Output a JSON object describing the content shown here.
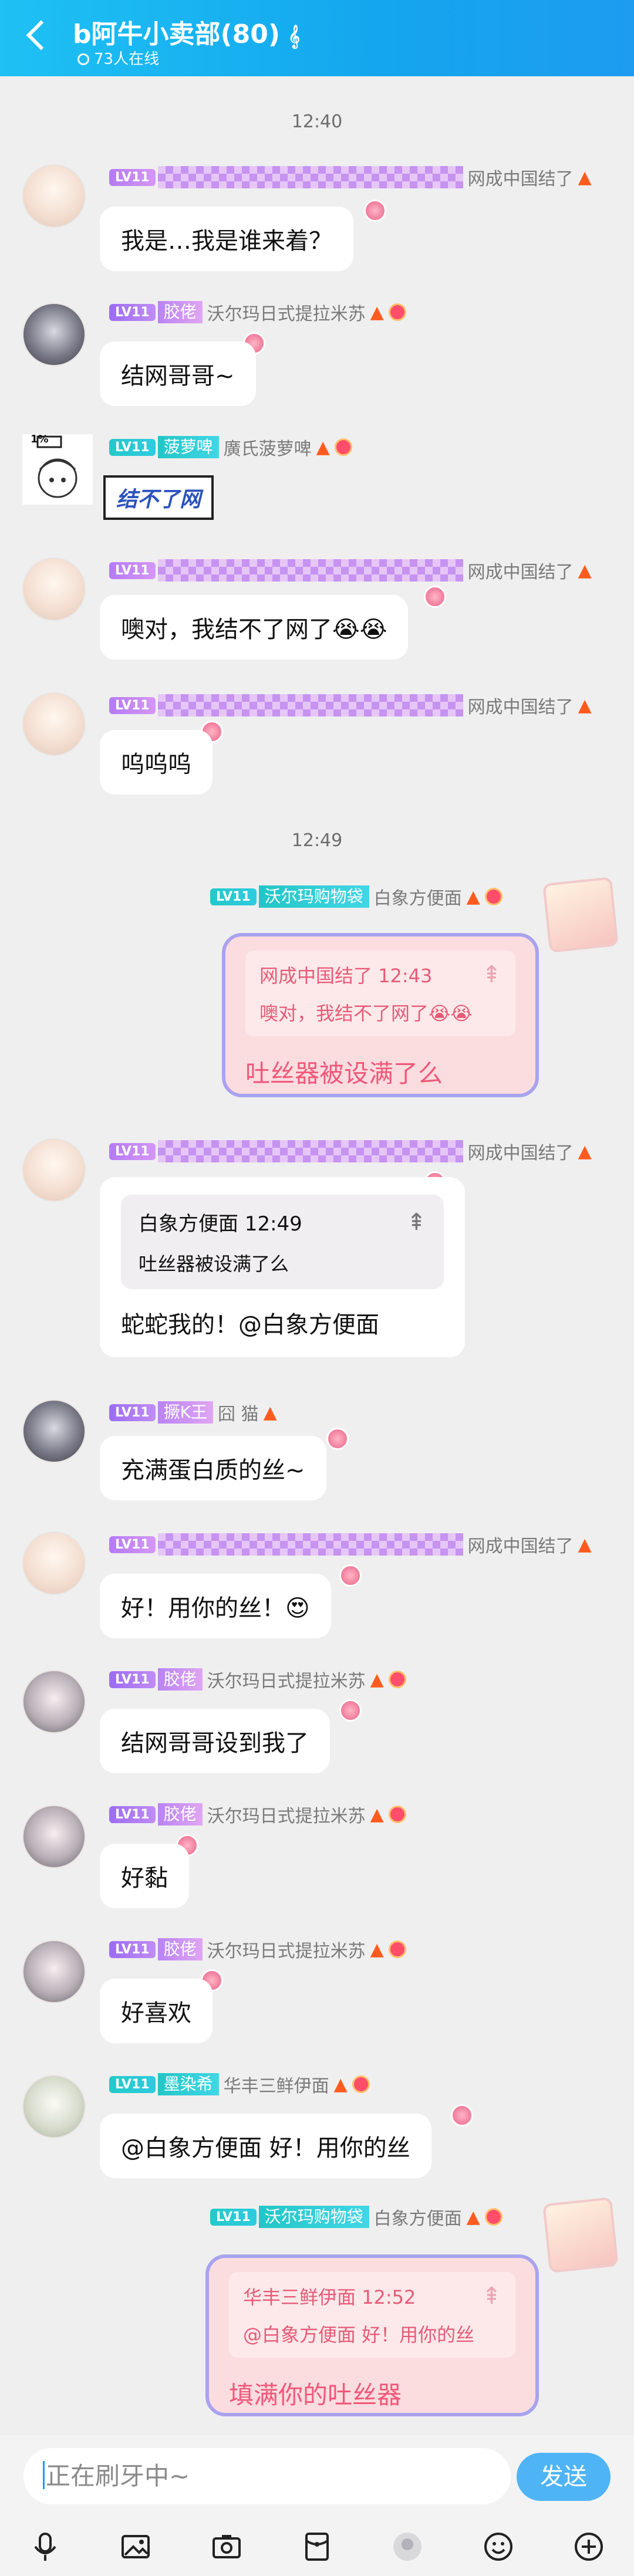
{
  "header": {
    "title": "b阿牛小卖部(80)",
    "online": "73人在线"
  },
  "times": [
    "12:40",
    "12:49"
  ],
  "messages": [
    {
      "lv": "LV11",
      "name": "网成中国结了",
      "text": "我是…我是谁来着？"
    },
    {
      "lv": "LV11",
      "tag": "胶佬",
      "name": "沃尔玛日式提拉米苏",
      "text": "结网哥哥~"
    },
    {
      "lv": "LV11",
      "tag": "菠萝啤",
      "name": "廣氏菠萝啤",
      "sticker": "结不了网",
      "battery": "1%"
    },
    {
      "lv": "LV11",
      "name": "网成中国结了",
      "text": "噢对，我结不了网了😭😭"
    },
    {
      "lv": "LV11",
      "name": "网成中国结了",
      "text": "呜呜呜"
    },
    {
      "lv": "LV11",
      "tag": "沃尔玛购物袋",
      "name": "白象方便面",
      "quote_author": "网成中国结了 12:43",
      "quote_text": "噢对，我结不了网了😭😭",
      "text": "吐丝器被设满了么"
    },
    {
      "lv": "LV11",
      "name": "网成中国结了",
      "quote_author": "白象方便面 12:49",
      "quote_text": "吐丝器被设满了么",
      "text": "蛇蛇我的！@白象方便面"
    },
    {
      "lv": "LV11",
      "tag": "撅K王",
      "name": "囧 猫",
      "text": "充满蛋白质的丝~"
    },
    {
      "lv": "LV11",
      "name": "网成中国结了",
      "text": "好！用你的丝！😍"
    },
    {
      "lv": "LV11",
      "tag": "胶佬",
      "name": "沃尔玛日式提拉米苏",
      "text": "结网哥哥设到我了"
    },
    {
      "lv": "LV11",
      "tag": "胶佬",
      "name": "沃尔玛日式提拉米苏",
      "text": "好黏"
    },
    {
      "lv": "LV11",
      "tag": "胶佬",
      "name": "沃尔玛日式提拉米苏",
      "text": "好喜欢"
    },
    {
      "lv": "LV11",
      "tag": "墨染希",
      "name": "华丰三鲜伊面",
      "text": "@白象方便面 好！用你的丝"
    },
    {
      "lv": "LV11",
      "tag": "沃尔玛购物袋",
      "name": "白象方便面",
      "quote_author": "华丰三鲜伊面 12:52",
      "quote_text": "@白象方便面 好！用你的丝",
      "text": "填满你的吐丝器"
    }
  ],
  "input": {
    "placeholder": "正在刷牙中~",
    "send": "发送"
  },
  "icons": [
    "microphone-icon",
    "image-icon",
    "camera-icon",
    "red-packet-icon",
    "avatar-icon",
    "emoji-icon",
    "plus-icon"
  ]
}
